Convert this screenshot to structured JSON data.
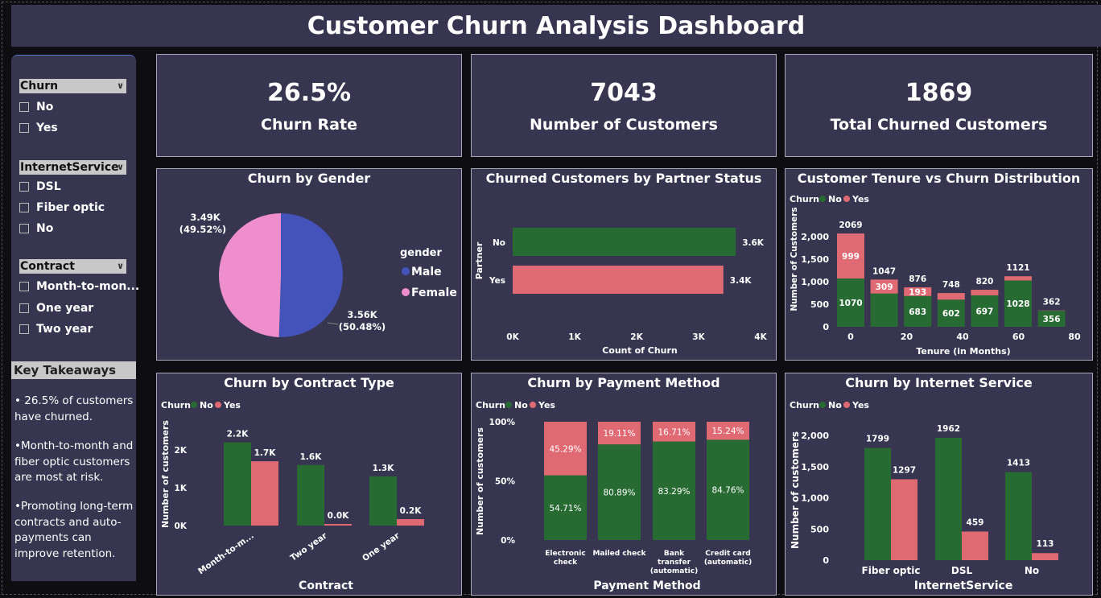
{
  "title": "Customer Churn Analysis Dashboard",
  "slicers": [
    {
      "title": "Churn",
      "items": [
        "No",
        "Yes"
      ]
    },
    {
      "title": "InternetService",
      "items": [
        "DSL",
        "Fiber optic",
        "No"
      ]
    },
    {
      "title": "Contract",
      "items": [
        "Month-to-mon...",
        "One year",
        "Two year"
      ]
    }
  ],
  "key_takeaways": {
    "title": "Key Takeaways",
    "items": [
      "• 26.5% of customers have churned.",
      "•Month-to-month and fiber optic customers are most at risk.",
      "•Promoting long-term contracts and auto-payments can improve retention."
    ]
  },
  "kpis": [
    {
      "value": "26.5%",
      "label": "Churn Rate"
    },
    {
      "value": "7043",
      "label": "Number of Customers"
    },
    {
      "value": "1869",
      "label": "Total Churned Customers"
    }
  ],
  "colors": {
    "no": "#276b33",
    "yes": "#e06a73",
    "male": "#4453b9",
    "female": "#ef8ecd",
    "panel": "#373550"
  },
  "chart_data": [
    {
      "type": "pie",
      "title": "Churn by Gender",
      "legend_title": "gender",
      "legend_position": "right",
      "slices": [
        {
          "name": "Male",
          "value": 3560,
          "label": "3.56K",
          "pct_label": "(50.48%)"
        },
        {
          "name": "Female",
          "value": 3490,
          "label": "3.49K",
          "pct_label": "(49.52%)"
        }
      ]
    },
    {
      "type": "bar",
      "orientation": "horizontal",
      "title": "Churned Customers by Partner Status",
      "xlabel": "Count of Churn",
      "ylabel": "Partner",
      "categories": [
        "No",
        "Yes"
      ],
      "values": [
        3600,
        3400
      ],
      "value_labels": [
        "3.6K",
        "3.4K"
      ],
      "xlim": [
        0,
        4000
      ],
      "xticks": [
        "0K",
        "1K",
        "2K",
        "3K",
        "4K"
      ]
    },
    {
      "type": "bar",
      "stacked": true,
      "title": "Customer Tenure vs Churn Distribution",
      "legend_title": "Churn",
      "xlabel": "Tenure (in Months)",
      "ylabel": "Number of Customers",
      "x": [
        0,
        10,
        20,
        30,
        40,
        50,
        60,
        70
      ],
      "series": [
        {
          "name": "No",
          "values": [
            1070,
            738,
            683,
            602,
            697,
            1028,
            356,
            0
          ]
        },
        {
          "name": "Yes",
          "values": [
            999,
            309,
            193,
            146,
            123,
            93,
            6,
            0
          ]
        }
      ],
      "totals": [
        2069,
        1047,
        876,
        748,
        820,
        1121,
        362,
        null
      ],
      "seg_labels_no": [
        "1070",
        "",
        "683",
        "602",
        "697",
        "1028",
        "356",
        ""
      ],
      "seg_labels_yes": [
        "999",
        "309",
        "193",
        "",
        "",
        "",
        "",
        ""
      ],
      "xticks": [
        "0",
        "20",
        "40",
        "60",
        "80"
      ],
      "yticks": [
        "0",
        "500",
        "1,000",
        "1,500",
        "2,000"
      ],
      "ylim": [
        0,
        2200
      ]
    },
    {
      "type": "bar",
      "title": "Churn by Contract Type",
      "legend_title": "Churn",
      "xlabel": "Contract",
      "ylabel": "Number of customers",
      "categories": [
        "Month-to-m...",
        "Two year",
        "One year"
      ],
      "series": [
        {
          "name": "No",
          "values": [
            2200,
            1600,
            1300
          ],
          "labels": [
            "2.2K",
            "1.6K",
            "1.3K"
          ]
        },
        {
          "name": "Yes",
          "values": [
            1700,
            40,
            170
          ],
          "labels": [
            "1.7K",
            "0.0K",
            "0.2K"
          ]
        }
      ],
      "yticks": [
        "0K",
        "1K",
        "2K"
      ],
      "ylim": [
        0,
        2600
      ]
    },
    {
      "type": "bar",
      "stacked": true,
      "percent": true,
      "title": "Churn by Payment Method",
      "legend_title": "Churn",
      "xlabel": "Payment Method",
      "ylabel": "Number of customers",
      "categories": [
        [
          "Electronic",
          "check"
        ],
        [
          "Mailed check"
        ],
        [
          "Bank",
          "transfer",
          "(automatic)"
        ],
        [
          "Credit card",
          "(automatic)"
        ]
      ],
      "series": [
        {
          "name": "No",
          "values": [
            54.71,
            80.89,
            83.29,
            84.76
          ],
          "labels": [
            "54.71%",
            "80.89%",
            "83.29%",
            "84.76%"
          ]
        },
        {
          "name": "Yes",
          "values": [
            45.29,
            19.11,
            16.71,
            15.24
          ],
          "labels": [
            "45.29%",
            "19.11%",
            "16.71%",
            "15.24%"
          ]
        }
      ],
      "yticks": [
        "0%",
        "50%",
        "100%"
      ]
    },
    {
      "type": "bar",
      "title": "Churn by Internet Service",
      "legend_title": "Churn",
      "xlabel": "InternetService",
      "ylabel": "Number of customers",
      "categories": [
        "Fiber optic",
        "DSL",
        "No"
      ],
      "series": [
        {
          "name": "No",
          "values": [
            1799,
            1962,
            1413
          ],
          "labels": [
            "1799",
            "1962",
            "1413"
          ]
        },
        {
          "name": "Yes",
          "values": [
            1297,
            459,
            113
          ],
          "labels": [
            "1297",
            "459",
            "113"
          ]
        }
      ],
      "yticks": [
        "0",
        "500",
        "1,000",
        "1,500",
        "2,000"
      ],
      "ylim": [
        0,
        2100
      ]
    }
  ]
}
